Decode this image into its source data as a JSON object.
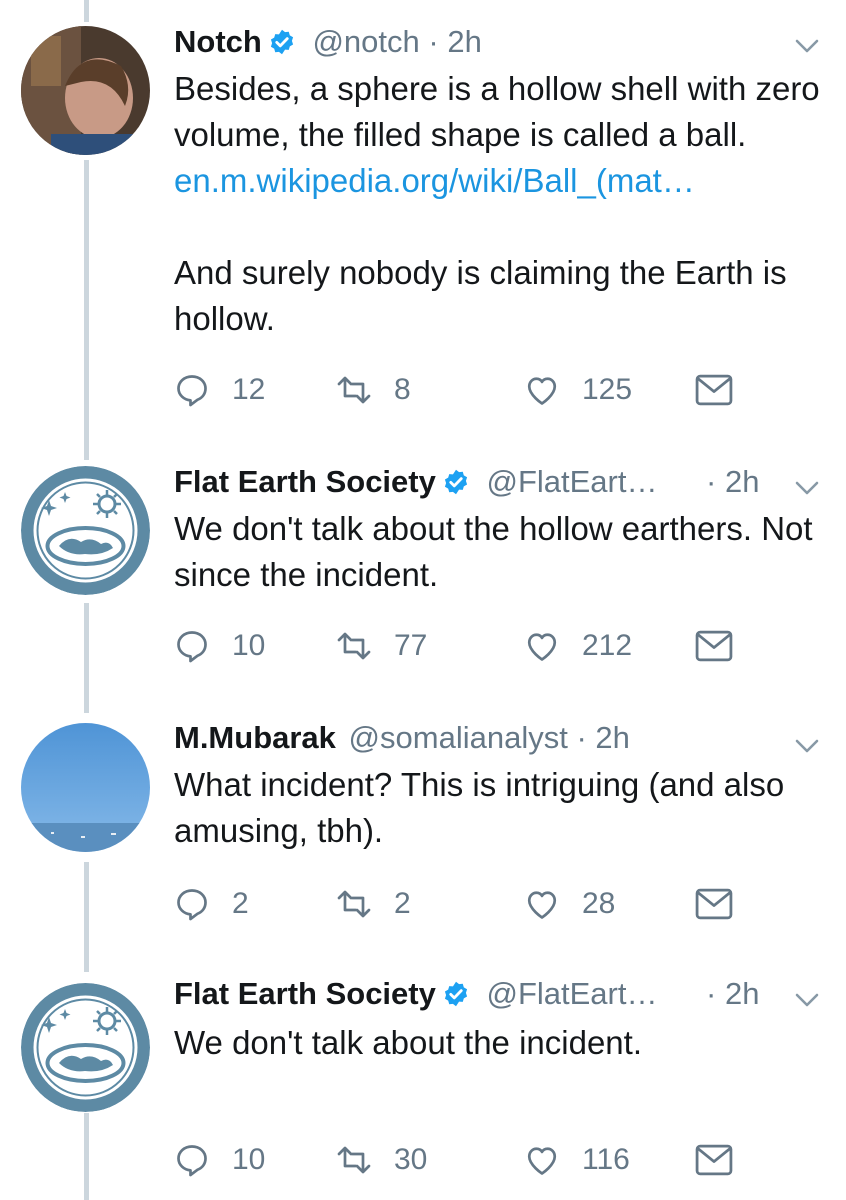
{
  "tweets": [
    {
      "name": "Notch",
      "verified": true,
      "handle": "@notch",
      "dot": "·",
      "time": "2h",
      "text_parts": [
        "Besides, a sphere is a hollow shell with zero volume, the filled shape is called a ball. ",
        "en.m.wikipedia.org/wiki/Ball_(mat…",
        "And surely nobody is claiming the Earth is hollow."
      ],
      "replies": "12",
      "retweets": "8",
      "likes": "125"
    },
    {
      "name": "Flat Earth Society",
      "verified": true,
      "handle": "@FlatEart…",
      "dot": "·",
      "time": "2h",
      "text": "We don't talk about the hollow earthers. Not since the incident.",
      "replies": "10",
      "retweets": "77",
      "likes": "212"
    },
    {
      "name": "M.Mubarak",
      "verified": false,
      "handle": "@somalianalyst",
      "dot": "·",
      "time": "2h",
      "text": "What incident? This is intriguing  (and also amusing, tbh).",
      "replies": "2",
      "retweets": "2",
      "likes": "28"
    },
    {
      "name": "Flat Earth Society",
      "verified": true,
      "handle": "@FlatEart…",
      "dot": "·",
      "time": "2h",
      "text": "We don't talk about the incident.",
      "replies": "10",
      "retweets": "30",
      "likes": "116"
    }
  ],
  "colors": {
    "link": "#1b95e0",
    "muted": "#657786",
    "verified": "#1da1f2",
    "thread_line": "#ccd6dd"
  },
  "icons": [
    "reply-icon",
    "retweet-icon",
    "like-icon",
    "direct-message-icon",
    "verified-badge-icon",
    "chevron-down-icon"
  ]
}
